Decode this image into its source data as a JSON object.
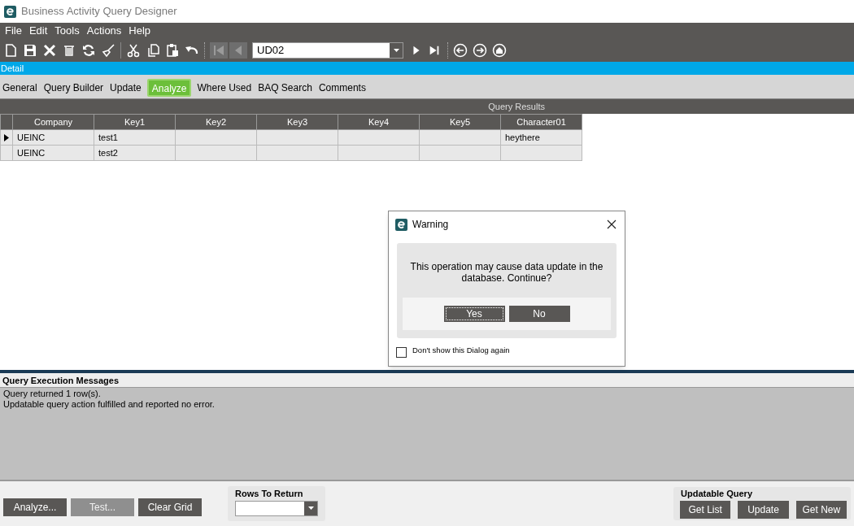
{
  "window": {
    "title": "Business Activity Query Designer"
  },
  "menu": [
    "File",
    "Edit",
    "Tools",
    "Actions",
    "Help"
  ],
  "navigation": [
    {
      "kind": "first",
      "disabled": true
    },
    {
      "kind": "prev",
      "disabled": true
    },
    {
      "kind": "next",
      "disabled": false
    },
    {
      "kind": "last",
      "disabled": false
    }
  ],
  "key_field": {
    "value": "UD02"
  },
  "section": "Detail",
  "tabs": [
    {
      "label": "General",
      "selected": false
    },
    {
      "label": "Query Builder",
      "selected": false
    },
    {
      "label": "Update",
      "selected": false
    },
    {
      "label": "Analyze",
      "selected": true
    },
    {
      "label": "Where Used",
      "selected": false
    },
    {
      "label": "BAQ Search",
      "selected": false
    },
    {
      "label": "Comments",
      "selected": false
    }
  ],
  "grid": {
    "title": "Query Results",
    "columns": [
      "Company",
      "Key1",
      "Key2",
      "Key3",
      "Key4",
      "Key5",
      "Character01"
    ],
    "rows": [
      {
        "selected": true,
        "cells": [
          "UEINC",
          "test1",
          "",
          "",
          "",
          "",
          "heythere"
        ]
      },
      {
        "selected": false,
        "cells": [
          "UEINC",
          "test2",
          "",
          "",
          "",
          "",
          ""
        ]
      }
    ]
  },
  "dialog": {
    "title": "Warning",
    "message": "This operation may cause data update in the database. Continue?",
    "buttons": [
      {
        "label": "Yes",
        "focused": true
      },
      {
        "label": "No",
        "focused": false
      }
    ],
    "checkbox": {
      "label": "Don't show this Dialog again",
      "checked": false
    }
  },
  "messages": {
    "title": "Query Execution Messages",
    "lines": [
      "Query returned 1 row(s).",
      "Updatable query action fulfilled and reported no error."
    ]
  },
  "actions": [
    {
      "label": "Analyze...",
      "disabled": false
    },
    {
      "label": "Test...",
      "disabled": true
    },
    {
      "label": "Clear Grid",
      "disabled": false
    }
  ],
  "rows_to_return": {
    "label": "Rows To Return"
  },
  "updatable_query": {
    "title": "Updatable Query",
    "buttons": [
      "Get List",
      "Update",
      "Get New"
    ]
  }
}
